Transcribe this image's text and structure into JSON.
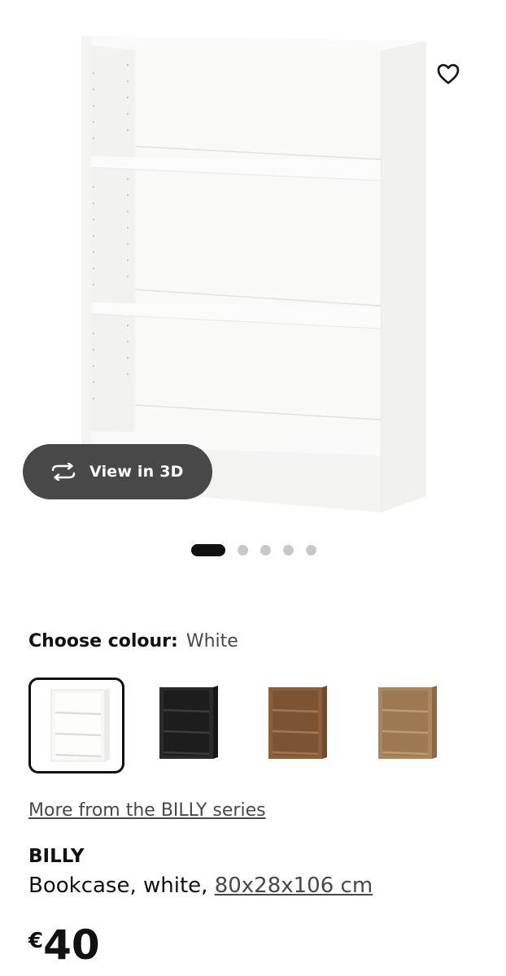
{
  "hero": {
    "image_icon": "white-bookcase-image",
    "view_3d_label": "View in 3D",
    "view_3d_icon": "rotate-3d-icon",
    "favourite_icon": "heart-icon",
    "carousel": {
      "total": 5,
      "active": 1
    }
  },
  "colour": {
    "label": "Choose colour:",
    "selected": "White",
    "options": [
      {
        "name": "White",
        "body": "#f7f7f5",
        "shade": "#e6e6e2"
      },
      {
        "name": "Black-brown",
        "body": "#2a2a2a",
        "shade": "#161616"
      },
      {
        "name": "Brown walnut effect",
        "body": "#8a5f3a",
        "shade": "#6f4a2b"
      },
      {
        "name": "Oak effect",
        "body": "#a98560",
        "shade": "#8b6a48"
      }
    ]
  },
  "series_link": "More from the BILLY series",
  "product": {
    "name": "BILLY",
    "description_prefix": "Bookcase, white,",
    "dimensions": "80x28x106 cm"
  },
  "price": {
    "currency": "€",
    "amount": "40"
  }
}
